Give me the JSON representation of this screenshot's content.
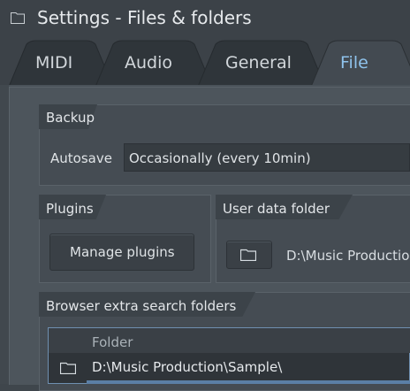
{
  "window": {
    "title": "Settings - Files & folders",
    "icon": "folder-icon"
  },
  "tabs": [
    {
      "label": "MIDI",
      "active": false
    },
    {
      "label": "Audio",
      "active": false
    },
    {
      "label": "General",
      "active": false
    },
    {
      "label": "File",
      "active": true
    }
  ],
  "colors": {
    "active_tab_text": "#8fc3ec",
    "selection_blue": "#5b7fa6"
  },
  "backup": {
    "title": "Backup",
    "autosave_label": "Autosave",
    "autosave_value": "Occasionally (every 10min)"
  },
  "plugins": {
    "title": "Plugins",
    "manage_label": "Manage plugins"
  },
  "user_data": {
    "title": "User data folder",
    "path": "D:\\Music Production",
    "browse_icon": "folder-icon"
  },
  "browser": {
    "title": "Browser extra search folders",
    "column_header": "Folder",
    "rows": [
      {
        "icon": "folder-icon",
        "path": "D:\\Music Production\\Sample\\"
      }
    ]
  }
}
